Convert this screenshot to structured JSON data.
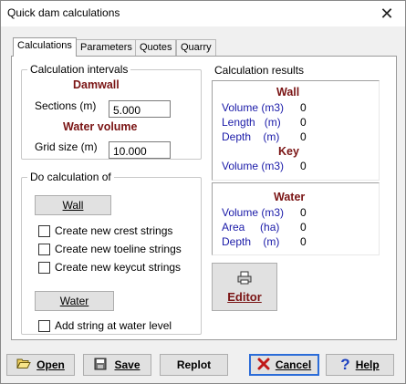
{
  "window": {
    "title": "Quick dam calculations",
    "close_glyph": "✕"
  },
  "tabs": [
    {
      "label": "Calculations",
      "active": true
    },
    {
      "label": "Parameters",
      "active": false
    },
    {
      "label": "Quotes",
      "active": false
    },
    {
      "label": "Quarry",
      "active": false
    }
  ],
  "intervals": {
    "group_label": "Calculation intervals",
    "damwall_heading": "Damwall",
    "sections_label": "Sections (m)",
    "sections_value": "5.000",
    "water_heading": "Water volume",
    "grid_label": "Grid size (m)",
    "grid_value": "10.000"
  },
  "do_calc": {
    "group_label": "Do calculation of",
    "wall_button": "Wall",
    "checks": [
      {
        "label": "Create new crest strings",
        "checked": false
      },
      {
        "label": "Create new toeline strings",
        "checked": false
      },
      {
        "label": "Create new keycut strings",
        "checked": false
      }
    ],
    "water_button": "Water",
    "water_check": {
      "label": "Add string at water level",
      "checked": false
    }
  },
  "results": {
    "group_label": "Calculation results",
    "wall_heading": "Wall",
    "wall_rows": [
      {
        "label": "Volume (m3)",
        "value": "0"
      },
      {
        "label": "Length   (m)",
        "value": "0"
      },
      {
        "label": "Depth    (m)",
        "value": "0"
      }
    ],
    "key_heading": "Key",
    "key_rows": [
      {
        "label": "Volume (m3)",
        "value": "0"
      }
    ],
    "water_heading": "Water",
    "water_rows": [
      {
        "label": "Volume (m3)",
        "value": "0"
      },
      {
        "label": "Area     (ha)",
        "value": "0"
      },
      {
        "label": "Depth    (m)",
        "value": "0"
      }
    ]
  },
  "editor_button": "Editor",
  "bottom": {
    "open": "Open",
    "save": "Save",
    "replot": "Replot",
    "cancel": "Cancel",
    "help": "Help"
  },
  "colors": {
    "heading": "#7a1414",
    "result_label": "#1a1aa8",
    "focus_border": "#2b6cd8",
    "cancel_icon": "#c01818",
    "help_icon": "#1a3fc0"
  },
  "icons": {
    "open": "folder-open-icon",
    "save": "save-icon",
    "editor": "printer-icon",
    "cancel": "x-icon",
    "help": "question-icon"
  }
}
